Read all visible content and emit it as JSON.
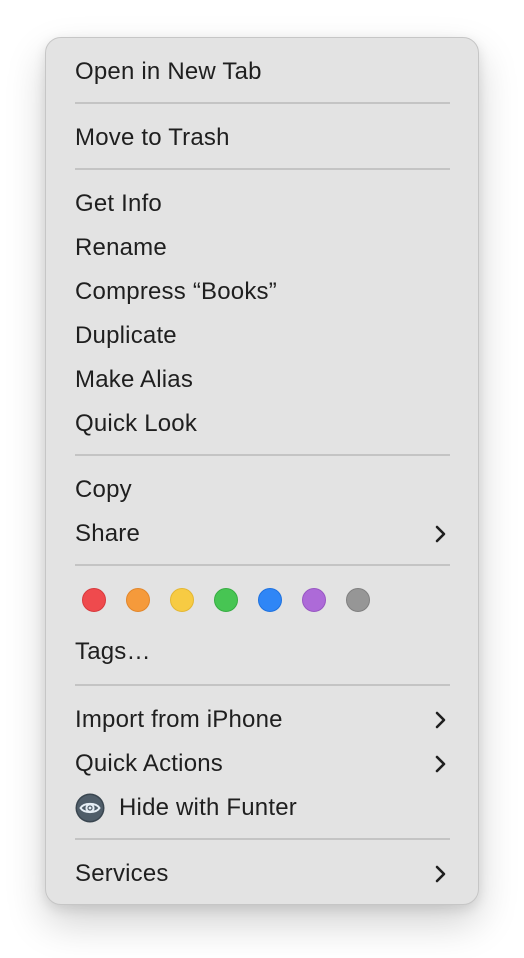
{
  "menu": {
    "items": {
      "open_new_tab": "Open in New Tab",
      "move_to_trash": "Move to Trash",
      "get_info": "Get Info",
      "rename": "Rename",
      "compress": "Compress “Books”",
      "duplicate": "Duplicate",
      "make_alias": "Make Alias",
      "quick_look": "Quick Look",
      "copy": "Copy",
      "share": "Share",
      "tags": "Tags…",
      "import_iphone": "Import from iPhone",
      "quick_actions": "Quick Actions",
      "hide_funter": "Hide with Funter",
      "services": "Services"
    },
    "tag_colors": [
      {
        "name": "red",
        "fill": "#ef4a4d",
        "stroke": "#d83a3d"
      },
      {
        "name": "orange",
        "fill": "#f59a3b",
        "stroke": "#e2872c"
      },
      {
        "name": "yellow",
        "fill": "#f7cb43",
        "stroke": "#e4b733"
      },
      {
        "name": "green",
        "fill": "#47c553",
        "stroke": "#37ad43"
      },
      {
        "name": "blue",
        "fill": "#2f86f6",
        "stroke": "#1f72df"
      },
      {
        "name": "purple",
        "fill": "#ad6ad8",
        "stroke": "#9857c3"
      },
      {
        "name": "gray",
        "fill": "#969696",
        "stroke": "#808080"
      }
    ],
    "icons": {
      "submenu": "chevron-right-icon",
      "funter": "eye-icon"
    }
  }
}
